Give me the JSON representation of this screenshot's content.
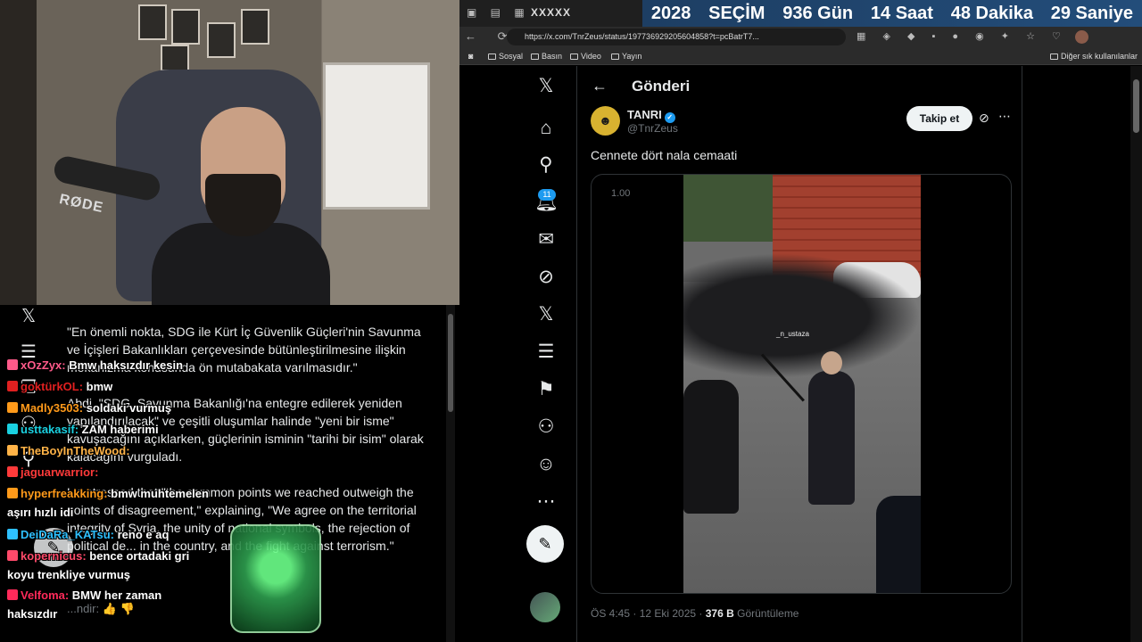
{
  "browser": {
    "tab_strip": "XXXXX",
    "countdown": {
      "year": "2028",
      "label": "SEÇİM",
      "days": "936 Gün",
      "hours": "14 Saat",
      "minutes": "48 Dakika",
      "seconds": "29 Saniye"
    },
    "url": "https://x.com/TnrZeus/status/197736929205604858?t=pcBatrT7...",
    "bookmarks": [
      "Sosyal",
      "Basın",
      "Video",
      "Yayın"
    ],
    "other_bookmarks": "Diğer sık kullanılanlar"
  },
  "x_nav": {
    "notification_count": "11",
    "icons": [
      "x-logo-icon",
      "home-icon",
      "search-icon",
      "bell-icon",
      "mail-icon",
      "grok-icon",
      "x-premium-icon",
      "lists-icon",
      "bookmark-icon",
      "communities-icon",
      "profile-icon",
      "more-icon",
      "post-icon"
    ]
  },
  "post": {
    "header_title": "Gönderi",
    "author_name": "TANRI",
    "author_handle": "@TnrZeus",
    "follow_label": "Takip et",
    "text": "Cennete dört nala cemaati",
    "video_speed": "1.00",
    "video_watermark": "_n_ustaza",
    "time": "ÖS 4:45 · 12 Eki 2025 · ",
    "views": "376 B",
    "views_label": " Görüntüleme"
  },
  "left_article": {
    "paragraphs": [
      "\"En önemli nokta, SDG ile Kürt İç Güvenlik Güçleri'nin Savunma ve İçişleri Bakanlıkları çerçevesinde bütünleştirilmesine ilişkin mekanizma konusunda ön mutabakata varılmasıdır.\"",
      "Abdi, \"SDG, Savunma Bakanlığı'na entegre edilerek yeniden yapılandırılacak\" ve çeşitli oluşumlar halinde \"yeni bir isme\" kavuşacağını açıklarken, güçlerinin isminin \"tarihi bir isim\" olarak kalacağını vurguladı.",
      "He stressed that \"the common points we reached outweigh the points of disagreement,\" explaining, \"We agree on the territorial integrity of Syria, the unity of national symbols, the rejection of political de... in the country, and the fight against terrorism.\""
    ],
    "meta": "...ndir:"
  },
  "chat": [
    {
      "user": "xOzZyx:",
      "text": "Bmw haksızdır kesin",
      "color": "#ff5a8a"
    },
    {
      "user": "goktürkOL:",
      "text": "bmw",
      "color": "#e02020"
    },
    {
      "user": "Madly3503:",
      "text": "soldaki vurmuş",
      "color": "#ff9a1a"
    },
    {
      "user": "usttakasif:",
      "text": "ZAM haberimi",
      "color": "#1ad0e0"
    },
    {
      "user": "TheBoyInTheWood:",
      "text": "",
      "color": "#ffb347"
    },
    {
      "user": "jaguarwarrior:",
      "text": "",
      "color": "#ff3a3a"
    },
    {
      "user": "hyperfreakking:",
      "text": "bmw muhtemelen",
      "color": "#ff9a1a"
    },
    {
      "user": "",
      "text": "aşırı hızlı idi",
      "color": "#ffffff"
    },
    {
      "user": "DeiDaRa_KATsu:",
      "text": "reno e aq",
      "color": "#2ec0ff"
    },
    {
      "user": "kopernicus:",
      "text": "bence ortadaki gri",
      "color": "#ff4a6a"
    },
    {
      "user": "",
      "text": "koyu trenkliye vurmuş",
      "color": "#ffffff"
    },
    {
      "user": "Velfoma:",
      "text": "BMW her zaman",
      "color": "#ff2a5a"
    },
    {
      "user": "",
      "text": "haksızdır",
      "color": "#ffffff"
    }
  ],
  "webcam": {
    "mic_brand": "RØDE"
  }
}
